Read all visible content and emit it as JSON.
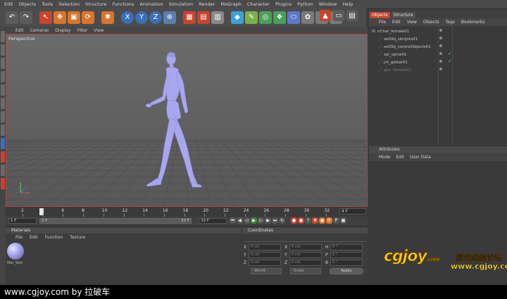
{
  "menubar": [
    "Edit",
    "Objects",
    "Tools",
    "Selection",
    "Structure",
    "Functions",
    "Animation",
    "Simulation",
    "Render",
    "MoGraph",
    "Character",
    "Plugins",
    "Python",
    "Window",
    "Help"
  ],
  "toolbar": {
    "axis_labels": [
      "X",
      "Y",
      "Z"
    ]
  },
  "viewport": {
    "menu": [
      "Edit",
      "Cameras",
      "Display",
      "Filter",
      "View"
    ],
    "label": "Perspective"
  },
  "timeline": {
    "ticks": [
      "2",
      "4",
      "6",
      "8",
      "10",
      "12",
      "14",
      "16",
      "18",
      "20",
      "22",
      "24",
      "26",
      "28",
      "30",
      "32"
    ],
    "end_field": "4 F",
    "start_field": "1 F",
    "current_field": "0 F",
    "max_field": "33 F",
    "max_field2": "33 F"
  },
  "materials": {
    "title": "Materials",
    "menu": [
      "File",
      "Edit",
      "Function",
      "Texture"
    ],
    "swatch_label": "Mat_Skin"
  },
  "coordinates": {
    "title": "Coordinates",
    "rows": [
      {
        "a": "X",
        "av": "0 cm",
        "b": "X",
        "bv": "0 cm",
        "c": "H",
        "cv": "0 °"
      },
      {
        "a": "Y",
        "av": "0 cm",
        "b": "Y",
        "bv": "0 cm",
        "c": "P",
        "cv": "0 °"
      },
      {
        "a": "Z",
        "av": "0 cm",
        "b": "Z",
        "bv": "0 cm",
        "c": "B",
        "cv": "0 °"
      }
    ],
    "world_label": "World",
    "scale_label": "Scale",
    "apply_label": "Apply"
  },
  "objects_panel": {
    "tabs": [
      "Objects",
      "Structure"
    ],
    "menu": [
      "File",
      "Edit",
      "View",
      "Objects",
      "Tags",
      "Bookmarks"
    ],
    "items": [
      {
        "name": "nChar_female01",
        "indent": 0
      },
      {
        "name": "selObj_skinJnts01",
        "indent": 1
      },
      {
        "name": "selObj_controlObjects01",
        "indent": 1
      },
      {
        "name": "spl_spine01",
        "indent": 1
      },
      {
        "name": "jnt_global01",
        "indent": 1
      },
      {
        "name": "geo_female01",
        "indent": 1
      }
    ]
  },
  "attributes_panel": {
    "title": "Attributes",
    "menu": [
      "Mode",
      "Edit",
      "User Data"
    ]
  },
  "caption": "www.cgjoy.com by 拉破车",
  "watermark": {
    "logo": "cgjoy",
    "dotcom": ".com",
    "text1": "游戏动画论坛",
    "text2": "www.cgjoy.com"
  },
  "colors": {
    "accent": "#c8442c",
    "figure": "#a7a6ee",
    "viewport_border": "#b84040"
  }
}
